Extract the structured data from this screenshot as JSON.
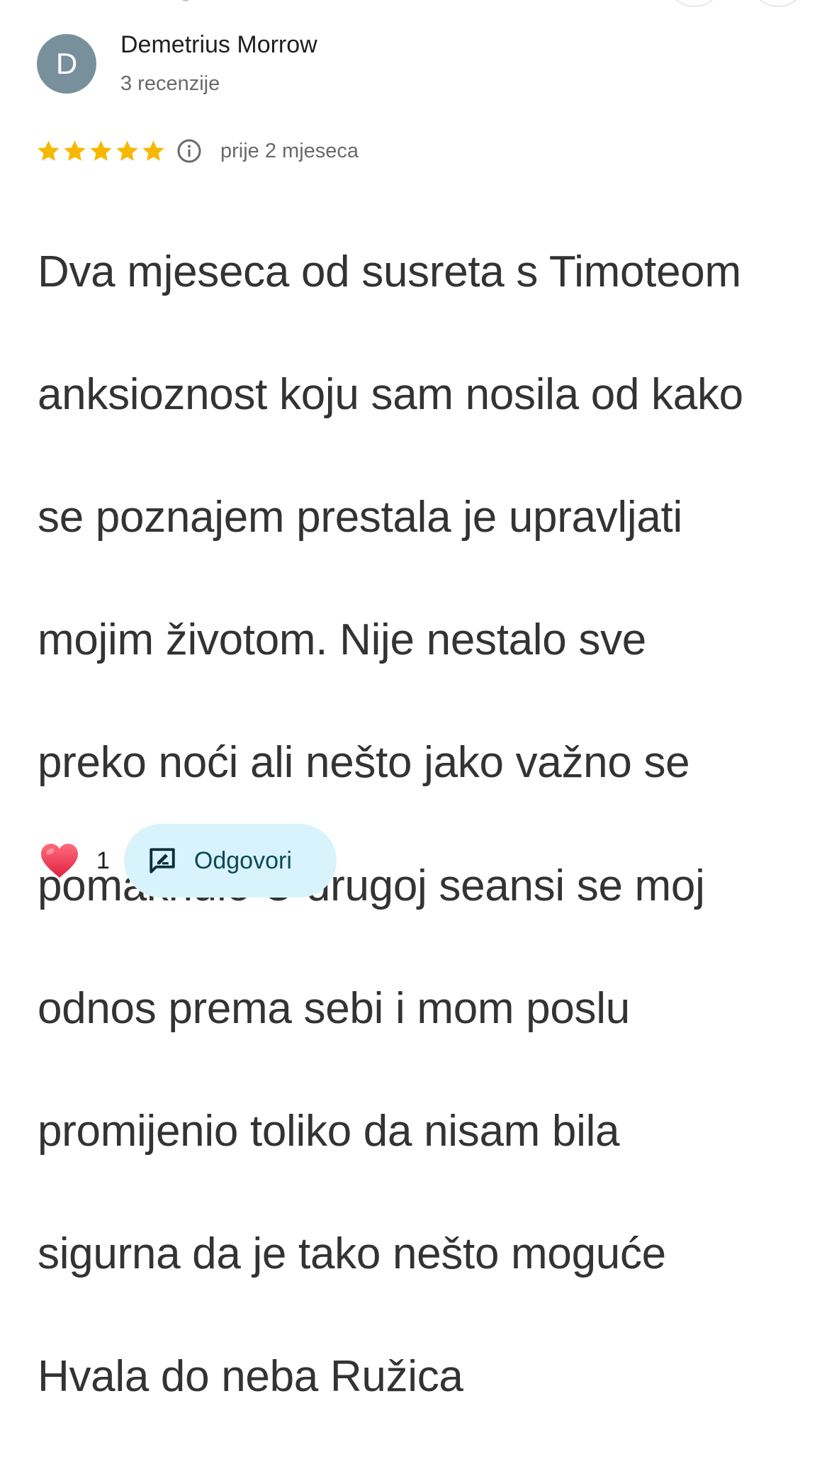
{
  "review": {
    "author": {
      "avatar_letter": "D",
      "avatar_color": "#78909c",
      "name": "Demetrius Morrow",
      "meta": "3 recenzije"
    },
    "rating": {
      "stars": 5,
      "max_stars": 5,
      "star_color": "#f6b800",
      "time_ago": "prije 2 mjeseca",
      "info_icon": "info-circle-icon"
    },
    "text_lines": [
      "Dva mjeseca od susreta s Timoteom",
      "anksioznost koju sam nosila od kako",
      "se  poznajem prestala je upravljati",
      "mojim životom.  Nije nestalo sve",
      "preko noći  ali nešto jako važno se",
      "pomaknulo  U drugoj seansi se moj",
      "odnos prema sebi i mom poslu",
      "promijenio toliko da nisam bila",
      "sigurna  da je tako nešto moguće",
      "Hvala do neba  Ružica"
    ],
    "actions": {
      "like_icon": "heart-icon",
      "like_count": "1",
      "reply_icon": "reply-icon",
      "reply_label": "Odgovori",
      "reply_bg_color": "#d8f3fb"
    }
  }
}
